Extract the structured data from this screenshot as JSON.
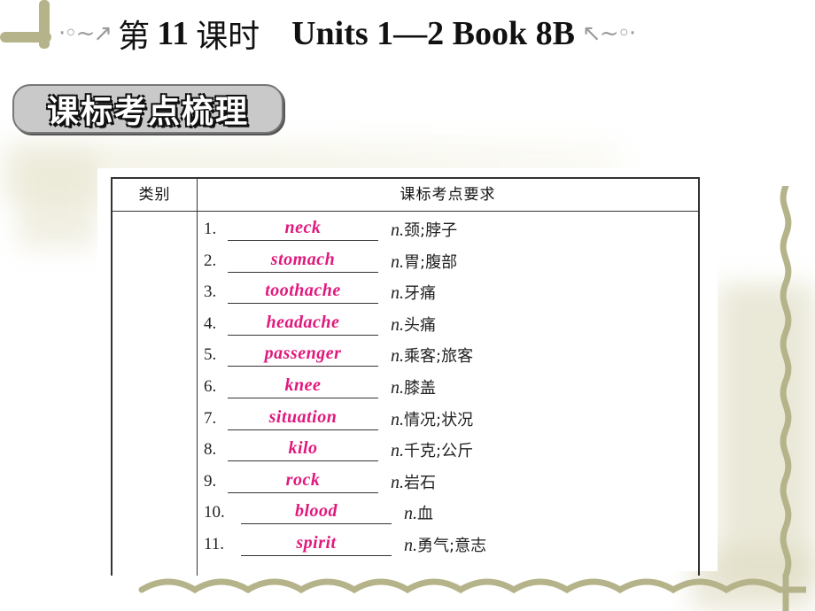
{
  "header": {
    "title_prefix": "第",
    "lesson_number": "11",
    "title_suffix": "课时",
    "title_english": "Units 1—2 Book 8B",
    "swirl_left": "·◦~↗",
    "swirl_right": "↖~◦·"
  },
  "section_badge": "课标考点梳理",
  "table": {
    "headers": [
      "类别",
      "课标考点要求"
    ],
    "items": [
      {
        "number": "1.",
        "answer": "neck",
        "pos": "n.",
        "meaning": "颈;脖子"
      },
      {
        "number": "2.",
        "answer": "stomach",
        "pos": "n.",
        "meaning": "胃;腹部"
      },
      {
        "number": "3.",
        "answer": "toothache",
        "pos": "n.",
        "meaning": "牙痛"
      },
      {
        "number": "4.",
        "answer": "headache",
        "pos": "n.",
        "meaning": "头痛"
      },
      {
        "number": "5.",
        "answer": "passenger",
        "pos": "n.",
        "meaning": "乘客;旅客"
      },
      {
        "number": "6.",
        "answer": "knee",
        "pos": "n.",
        "meaning": "膝盖"
      },
      {
        "number": "7.",
        "answer": "situation",
        "pos": "n.",
        "meaning": "情况;状况"
      },
      {
        "number": "8.",
        "answer": "kilo",
        "pos": "n.",
        "meaning": "千克;公斤"
      },
      {
        "number": "9.",
        "answer": "rock",
        "pos": "n.",
        "meaning": "岩石"
      },
      {
        "number": "10.",
        "answer": "blood",
        "pos": "n.",
        "meaning": "血"
      },
      {
        "number": "11.",
        "answer": "spirit",
        "pos": "n.",
        "meaning": "勇气;意志"
      }
    ]
  },
  "colors": {
    "answer": "#e0197d",
    "vine": "#b5b38a",
    "badge_bg": "#c9c9c9"
  }
}
